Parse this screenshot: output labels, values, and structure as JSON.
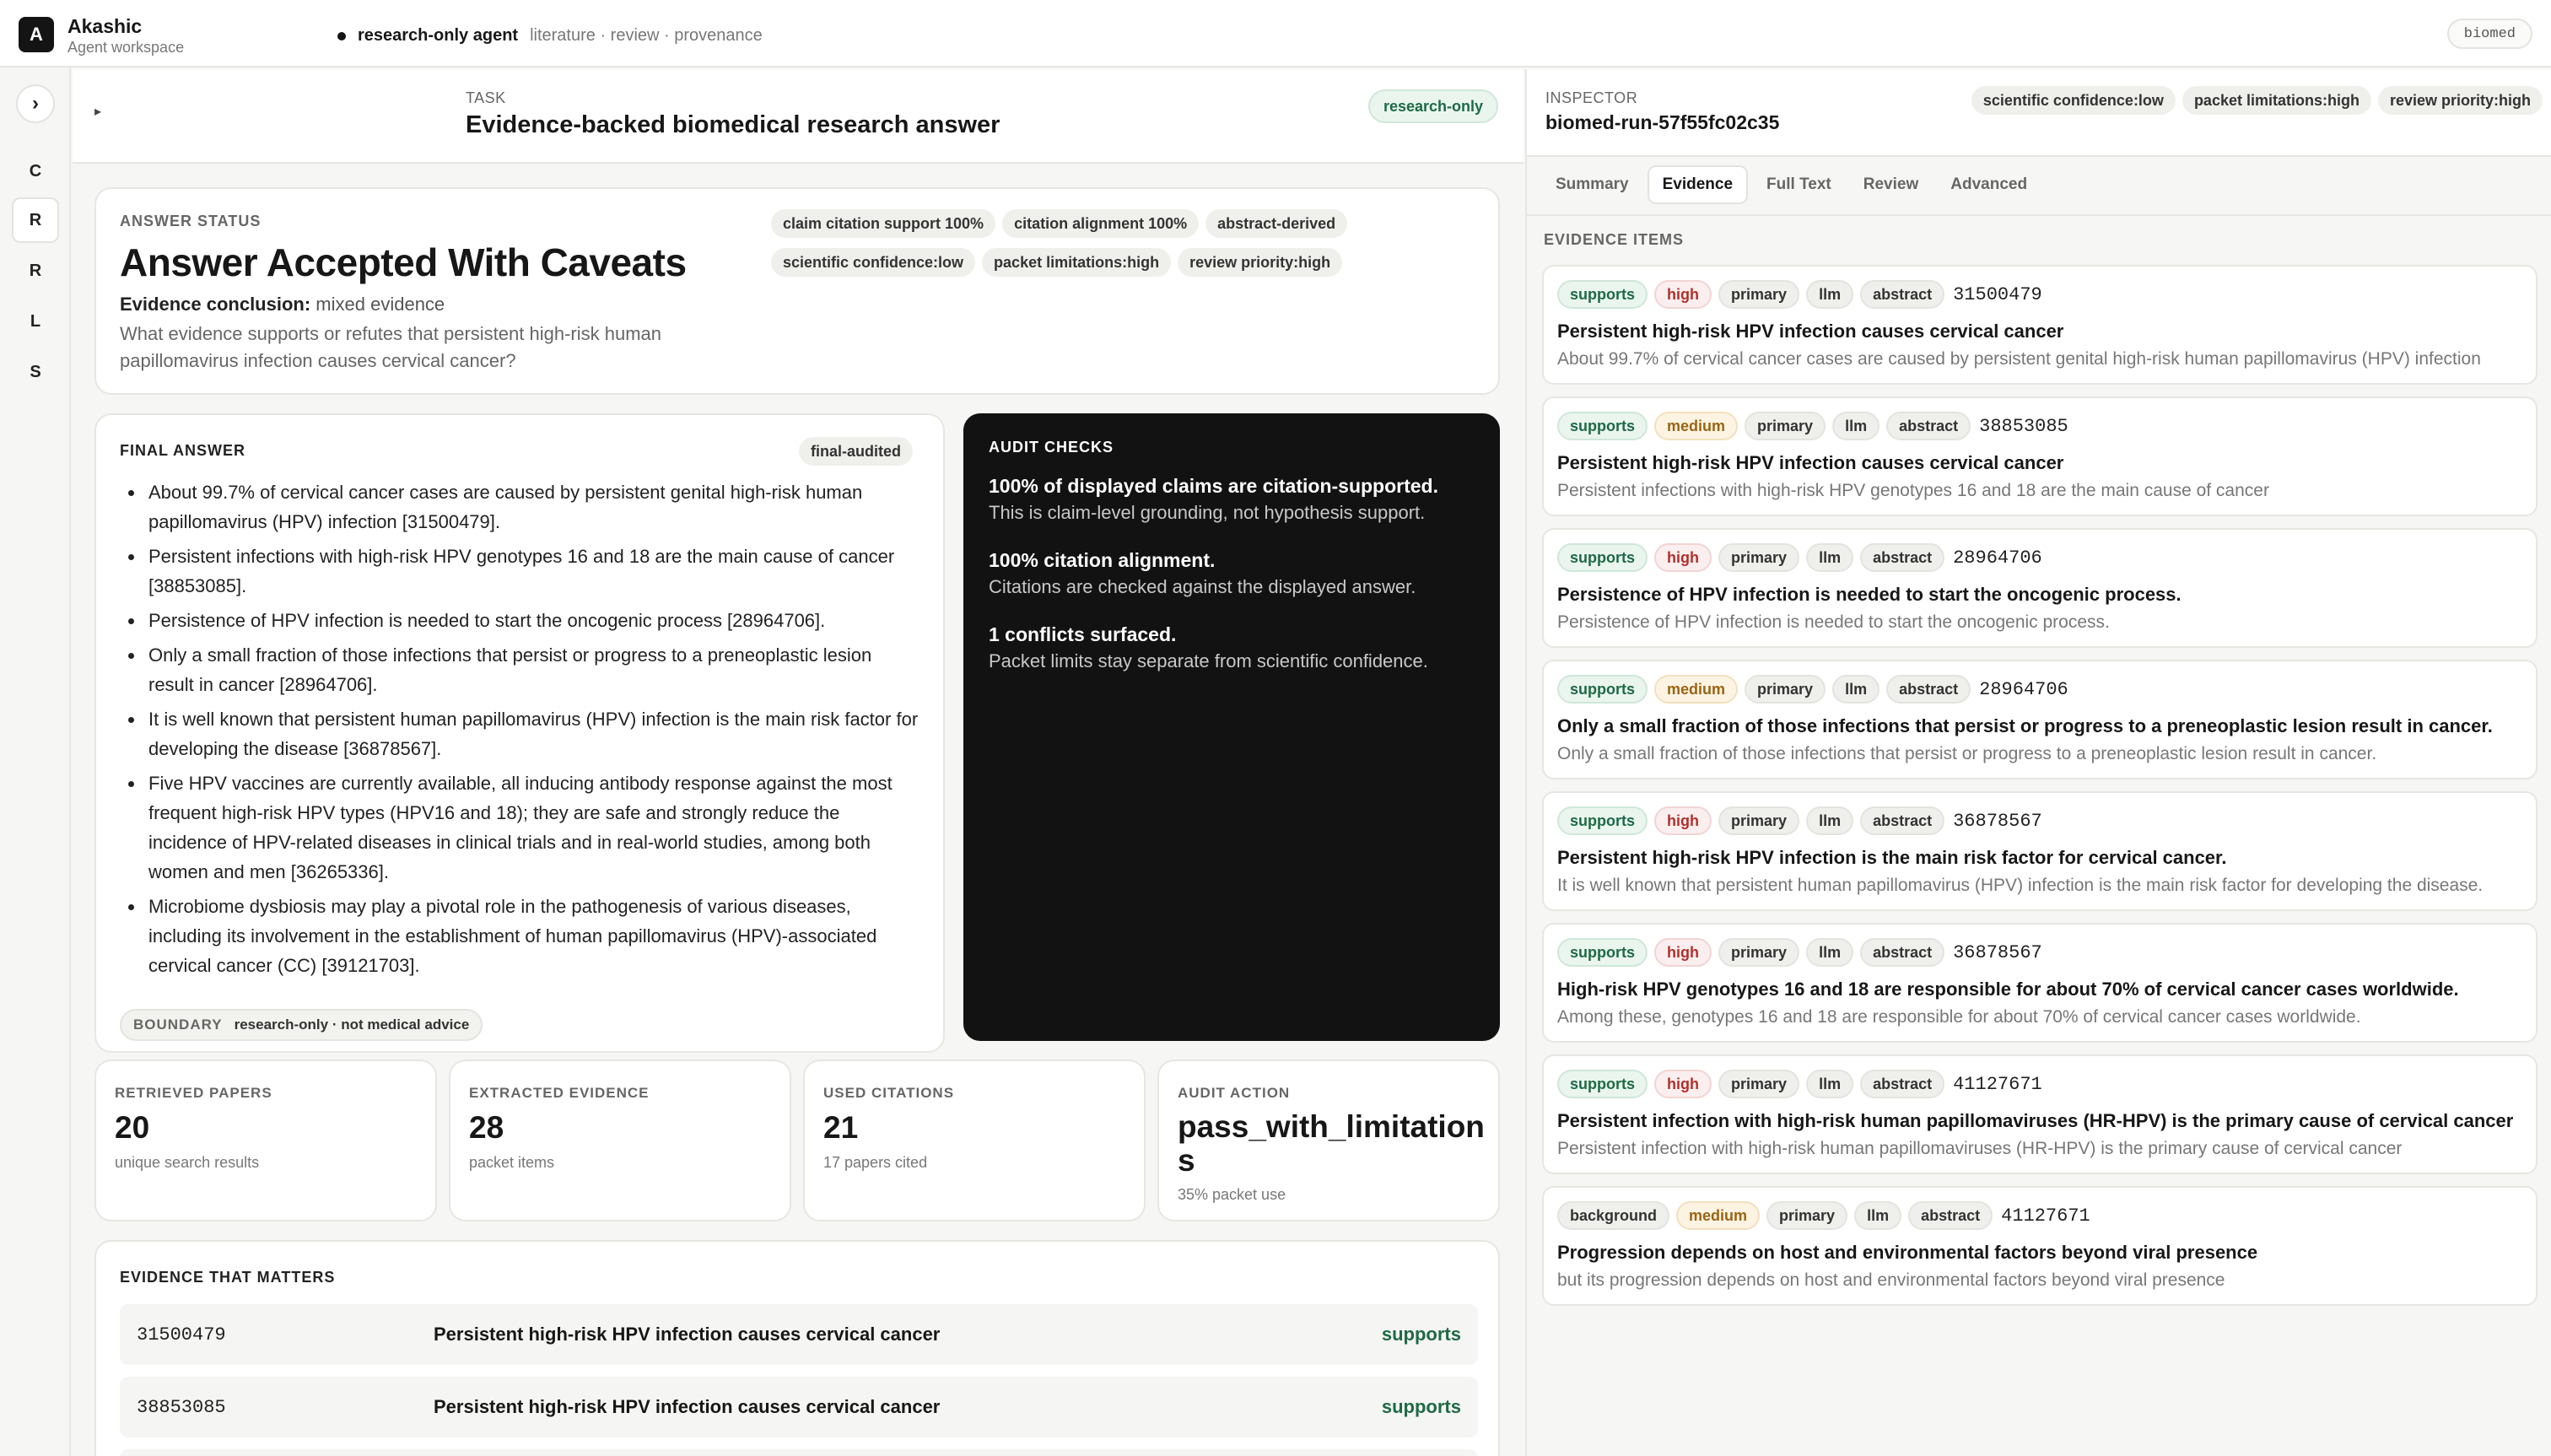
{
  "app": {
    "logo_letter": "A",
    "name": "Akashic",
    "subtitle": "Agent workspace",
    "agent_mode": "research-only agent",
    "agent_desc": "literature · review · provenance",
    "env_badge": "biomed"
  },
  "rail": {
    "toggle_glyph": "›",
    "items": [
      "C",
      "R",
      "R",
      "L",
      "S"
    ],
    "active_index": 1
  },
  "task": {
    "caret": "▸",
    "label": "TASK",
    "title": "Evidence-backed biomedical research answer",
    "mode_pill": "research-only"
  },
  "status": {
    "label": "ANSWER STATUS",
    "title": "Answer Accepted With Caveats",
    "conclusion_label": "Evidence conclusion:",
    "conclusion_value": "mixed evidence",
    "question": "What evidence supports or refutes that persistent high-risk human papillomavirus infection causes cervical cancer?",
    "chips": [
      "claim citation support 100%",
      "citation alignment 100%",
      "abstract-derived",
      "scientific confidence:low",
      "packet limitations:high",
      "review priority:high"
    ]
  },
  "final_answer": {
    "label": "FINAL ANSWER",
    "badge": "final-audited",
    "items": [
      "About 99.7% of cervical cancer cases are caused by persistent genital high-risk human papillomavirus (HPV) infection [31500479].",
      "Persistent infections with high-risk HPV genotypes 16 and 18 are the main cause of cancer [38853085].",
      "Persistence of HPV infection is needed to start the oncogenic process [28964706].",
      "Only a small fraction of those infections that persist or progress to a preneoplastic lesion result in cancer [28964706].",
      "It is well known that persistent human papillomavirus (HPV) infection is the main risk factor for developing the disease [36878567].",
      "Five HPV vaccines are currently available, all inducing antibody response against the most frequent high-risk HPV types (HPV16 and 18); they are safe and strongly reduce the incidence of HPV-related diseases in clinical trials and in real-world studies, among both women and men [36265336].",
      "Microbiome dysbiosis may play a pivotal role in the pathogenesis of various diseases, including its involvement in the establishment of human papillomavirus (HPV)-associated cervical cancer (CC) [39121703]."
    ],
    "boundary_label": "BOUNDARY",
    "boundary_value": "research-only · not medical advice"
  },
  "audit": {
    "label": "AUDIT CHECKS",
    "items": [
      {
        "title": "100% of displayed claims are citation-supported.",
        "desc": "This is claim-level grounding, not hypothesis support."
      },
      {
        "title": "100% citation alignment.",
        "desc": "Citations are checked against the displayed answer."
      },
      {
        "title": "1 conflicts surfaced.",
        "desc": "Packet limits stay separate from scientific confidence."
      }
    ]
  },
  "metrics": [
    {
      "label": "RETRIEVED PAPERS",
      "value": "20",
      "sub": "unique search results"
    },
    {
      "label": "EXTRACTED EVIDENCE",
      "value": "28",
      "sub": "packet items"
    },
    {
      "label": "USED CITATIONS",
      "value": "21",
      "sub": "17 papers cited"
    },
    {
      "label": "AUDIT ACTION",
      "value": "pass_with_limitations",
      "sub": "35% packet use"
    }
  ],
  "matters": {
    "label": "EVIDENCE THAT MATTERS",
    "rows": [
      {
        "pmid": "31500479",
        "claim": "Persistent high-risk HPV infection causes cervical cancer",
        "stance": "supports"
      },
      {
        "pmid": "38853085",
        "claim": "Persistent high-risk HPV infection causes cervical cancer",
        "stance": "supports"
      }
    ]
  },
  "inspector": {
    "label": "INSPECTOR",
    "run_id": "biomed-run-57f55fc02c35",
    "chips": [
      "scientific confidence:low",
      "packet limitations:high",
      "review priority:high"
    ],
    "tabs": [
      "Summary",
      "Evidence",
      "Full Text",
      "Review",
      "Advanced"
    ],
    "active_tab": 1,
    "evidence_label": "EVIDENCE ITEMS",
    "evidence": [
      {
        "stance": "supports",
        "strength": "high",
        "tier": "primary",
        "method": "llm",
        "source": "abstract",
        "pmid": "31500479",
        "title": "Persistent high-risk HPV infection causes cervical cancer",
        "quote": "About 99.7% of cervical cancer cases are caused by persistent genital high-risk human papillomavirus (HPV) infection"
      },
      {
        "stance": "supports",
        "strength": "medium",
        "tier": "primary",
        "method": "llm",
        "source": "abstract",
        "pmid": "38853085",
        "title": "Persistent high-risk HPV infection causes cervical cancer",
        "quote": "Persistent infections with high-risk HPV genotypes 16 and 18 are the main cause of cancer"
      },
      {
        "stance": "supports",
        "strength": "high",
        "tier": "primary",
        "method": "llm",
        "source": "abstract",
        "pmid": "28964706",
        "title": "Persistence of HPV infection is needed to start the oncogenic process.",
        "quote": "Persistence of HPV infection is needed to start the oncogenic process."
      },
      {
        "stance": "supports",
        "strength": "medium",
        "tier": "primary",
        "method": "llm",
        "source": "abstract",
        "pmid": "28964706",
        "title": "Only a small fraction of those infections that persist or progress to a preneoplastic lesion result in cancer.",
        "quote": "Only a small fraction of those infections that persist or progress to a preneoplastic lesion result in cancer."
      },
      {
        "stance": "supports",
        "strength": "high",
        "tier": "primary",
        "method": "llm",
        "source": "abstract",
        "pmid": "36878567",
        "title": "Persistent high-risk HPV infection is the main risk factor for cervical cancer.",
        "quote": "It is well known that persistent human papillomavirus (HPV) infection is the main risk factor for developing the disease."
      },
      {
        "stance": "supports",
        "strength": "high",
        "tier": "primary",
        "method": "llm",
        "source": "abstract",
        "pmid": "36878567",
        "title": "High-risk HPV genotypes 16 and 18 are responsible for about 70% of cervical cancer cases worldwide.",
        "quote": "Among these, genotypes 16 and 18 are responsible for about 70% of cervical cancer cases worldwide."
      },
      {
        "stance": "supports",
        "strength": "high",
        "tier": "primary",
        "method": "llm",
        "source": "abstract",
        "pmid": "41127671",
        "title": "Persistent infection with high-risk human papillomaviruses (HR-HPV) is the primary cause of cervical cancer",
        "quote": "Persistent infection with high-risk human papillomaviruses (HR-HPV) is the primary cause of cervical cancer"
      },
      {
        "stance": "background",
        "strength": "medium",
        "tier": "primary",
        "method": "llm",
        "source": "abstract",
        "pmid": "41127671",
        "title": "Progression depends on host and environmental factors beyond viral presence",
        "quote": "but its progression depends on host and environmental factors beyond viral presence"
      }
    ]
  }
}
